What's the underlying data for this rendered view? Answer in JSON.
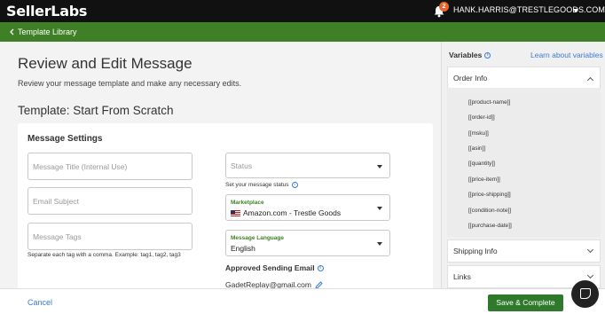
{
  "header": {
    "logo_part1": "Seller",
    "logo_part2": "Labs",
    "notification_count": "2",
    "user_email": "HANK.HARRIS@TRESTLEGOODS.COM"
  },
  "nav": {
    "back_label": "Template Library"
  },
  "page": {
    "title": "Review and Edit Message",
    "subtitle": "Review your message template and make any necessary edits.",
    "template_title": "Template: Start From Scratch"
  },
  "settings": {
    "title": "Message Settings",
    "message_title_placeholder": "Message Title (Internal Use)",
    "email_subject_placeholder": "Email Subject",
    "message_tags_placeholder": "Message Tags",
    "tags_helper": "Separate each tag with a comma. Example: tag1, tag2, tag3",
    "status_placeholder": "Status",
    "status_helper": "Set your message status",
    "marketplace_label": "Marketplace",
    "marketplace_value": "Amazon.com - Trestle Goods",
    "language_label": "Message Language",
    "language_value": "English",
    "approved_label": "Approved Sending Email",
    "approved_email": "GadetReplay@gmail.com"
  },
  "sidebar": {
    "title": "Variables",
    "learn_link": "Learn about variables",
    "order_info_label": "Order Info",
    "order_variables": [
      "[[product-name]]",
      "[[order-id]]",
      "[[msku]]",
      "[[asin]]",
      "[[quantity]]",
      "[[price-item]]",
      "[[price-shipping]]",
      "[[condition-note]]",
      "[[purchase-date]]"
    ],
    "shipping_info_label": "Shipping Info",
    "links_label": "Links"
  },
  "footer": {
    "cancel_label": "Cancel",
    "save_label": "Save & Complete"
  },
  "colors": {
    "brand_green": "#3f7f26",
    "button_green": "#2f7a2a",
    "link_blue": "#3a7bd5",
    "badge_orange": "#e8652a"
  }
}
